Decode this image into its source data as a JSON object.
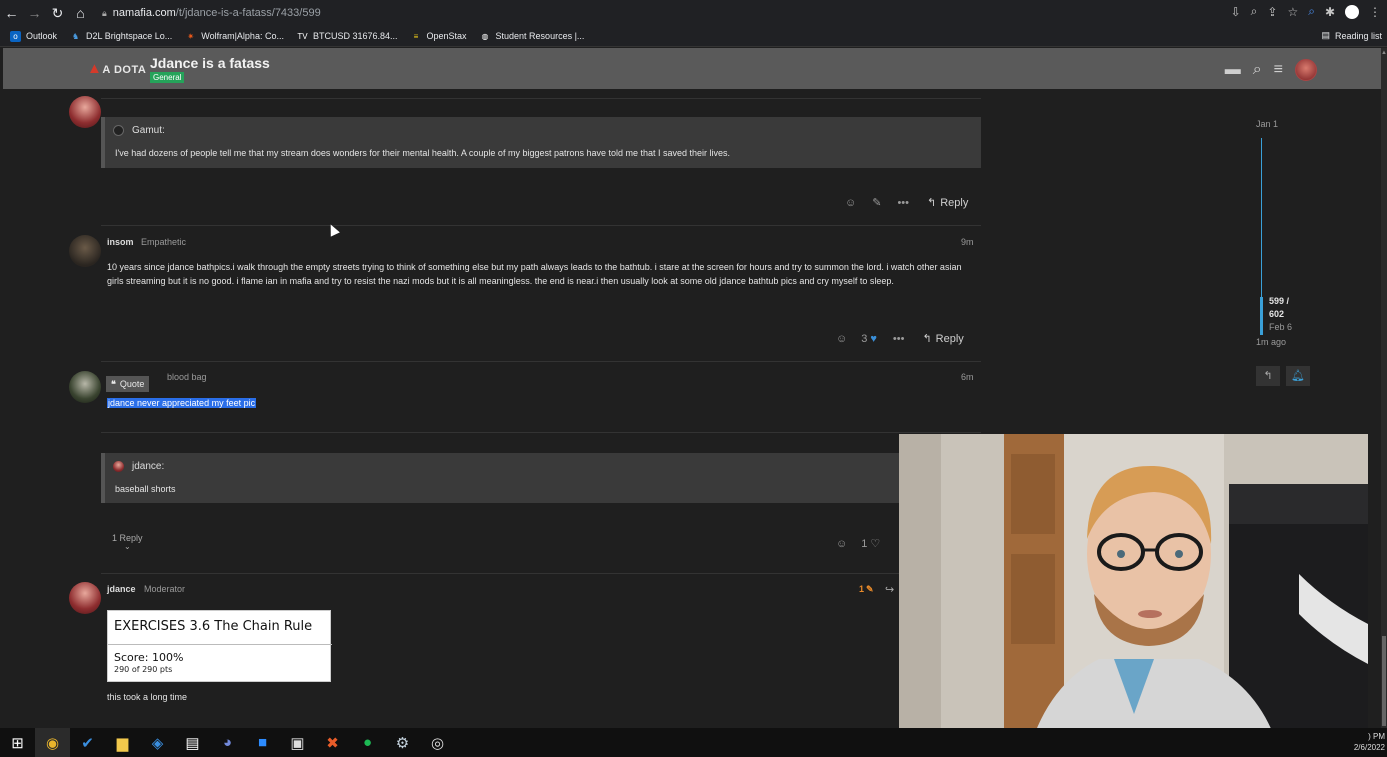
{
  "browser": {
    "url_host": "namafia.com",
    "url_path": "/t/jdance-is-a-fatass/7433/599",
    "bookmarks": [
      {
        "label": "Outlook",
        "icon": "outlook-icon",
        "color": "#0a64c2"
      },
      {
        "label": "D2L Brightspace Lo...",
        "icon": "d2l-icon",
        "color": "#1b75bb"
      },
      {
        "label": "Wolfram|Alpha: Co...",
        "icon": "wolfram-icon",
        "color": "#e8581a"
      },
      {
        "label": "BTCUSD 31676.84...",
        "icon": "tradingview-icon",
        "color": "#ffffff"
      },
      {
        "label": "OpenStax",
        "icon": "openstax-icon",
        "color": "#f4d019"
      },
      {
        "label": "Student Resources |...",
        "icon": "globe-icon",
        "color": "#ffffff"
      }
    ],
    "reading_list": "Reading list"
  },
  "header": {
    "logo": "A DOTA",
    "topic_title": "Jdance is a fatass",
    "category": "General",
    "category_color": "#25a35a"
  },
  "posts": {
    "p1": {
      "quote_author": "Gamut:",
      "quote_text": "I've had dozens of people tell me that my stream does wonders for their mental health. A couple of my biggest patrons have told me that I saved their lives.",
      "reply_label": "Reply"
    },
    "p2": {
      "username": "insom",
      "user_title": "Empathetic",
      "time": "9m",
      "text": "10 years since jdance bathpics.i walk through the empty streets trying to think of something else but my path always leads to the bathtub. i stare at the screen for hours and try to summon the lord. i watch other asian girls streaming but it is no good. i flame ian in mafia and try to resist the nazi mods but it is all meaningless. the end is near.i then usually look at some old jdance bathtub pics and cry myself to sleep.",
      "likes": "3",
      "reply_label": "Reply"
    },
    "p3": {
      "user_title": "blood bag",
      "time": "6m",
      "quote_popup": "Quote",
      "text": "jdance never appreciated my feet pic",
      "quote_author": "jdance:",
      "quote_text": "baseball shorts",
      "replies": "1 Reply",
      "likes": "1"
    },
    "p4": {
      "username": "jdance",
      "user_title": "Moderator",
      "edits": "1",
      "image_title": "EXERCISES 3.6 The Chain Rule",
      "image_score": "Score: 100%",
      "image_pts": "290 of 290 pts",
      "text": "this took a long time"
    }
  },
  "timeline": {
    "start": "Jan 1",
    "position": "599 /",
    "total": "602",
    "date": "Feb 6",
    "ago": "1m ago",
    "accent": "#3aa0d8"
  },
  "taskbar": {
    "clock_time": ") PM",
    "clock_date": "2/6/2022"
  }
}
